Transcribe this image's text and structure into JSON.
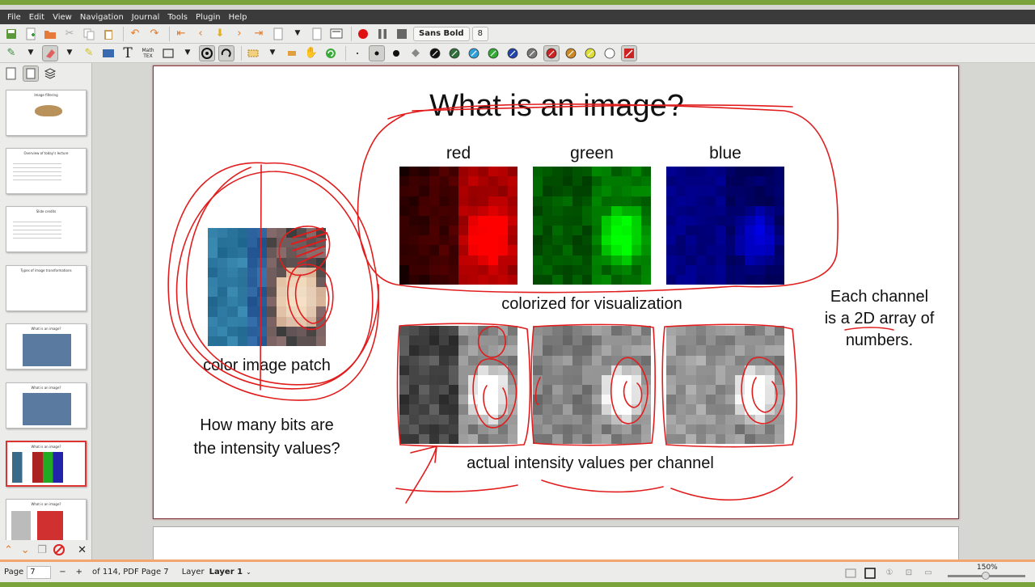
{
  "menu": [
    "File",
    "Edit",
    "View",
    "Navigation",
    "Journal",
    "Tools",
    "Plugin",
    "Help"
  ],
  "toolbar": {
    "font_name": "Sans Bold",
    "font_size": "8",
    "mathtex_top": "Math",
    "mathtex_bottom": "TEX",
    "pen_colors": [
      "#111111",
      "#2f6f3a",
      "#2fa0d8",
      "#33aa33",
      "#2244aa",
      "#777777",
      "#cc2222",
      "#cc8822",
      "#dddd33",
      "#ffffff"
    ]
  },
  "sidebar": {
    "thumbs": [
      {
        "title": "Image filtering"
      },
      {
        "title": "Overview of today's lecture"
      },
      {
        "title": "Slide credits"
      },
      {
        "title": "Types of image transformations"
      },
      {
        "title": "What is an image?"
      },
      {
        "title": "What is an image?"
      },
      {
        "title": "What is an image?"
      },
      {
        "title": "What is an image?"
      }
    ]
  },
  "slide": {
    "title": "What is an image?",
    "channels": [
      "red",
      "green",
      "blue"
    ],
    "colorized_caption": "colorized for visualization",
    "patch_caption": "color image patch",
    "question_line1": "How many bits are",
    "question_line2": "the intensity  values?",
    "intensity_caption": "actual intensity values per channel",
    "side_line1": "Each channel",
    "side_line2": "is a 2D array of",
    "side_line3": "numbers."
  },
  "status": {
    "page_label": "Page",
    "page_value": "7",
    "page_info": "of 114, PDF Page 7",
    "layer_label": "Layer",
    "layer_value": "Layer 1",
    "zoom": "150%"
  },
  "colors": {
    "frame": "#7aa33b",
    "annotation": "#e11d1d",
    "accent_bar": "#f2a56e"
  }
}
